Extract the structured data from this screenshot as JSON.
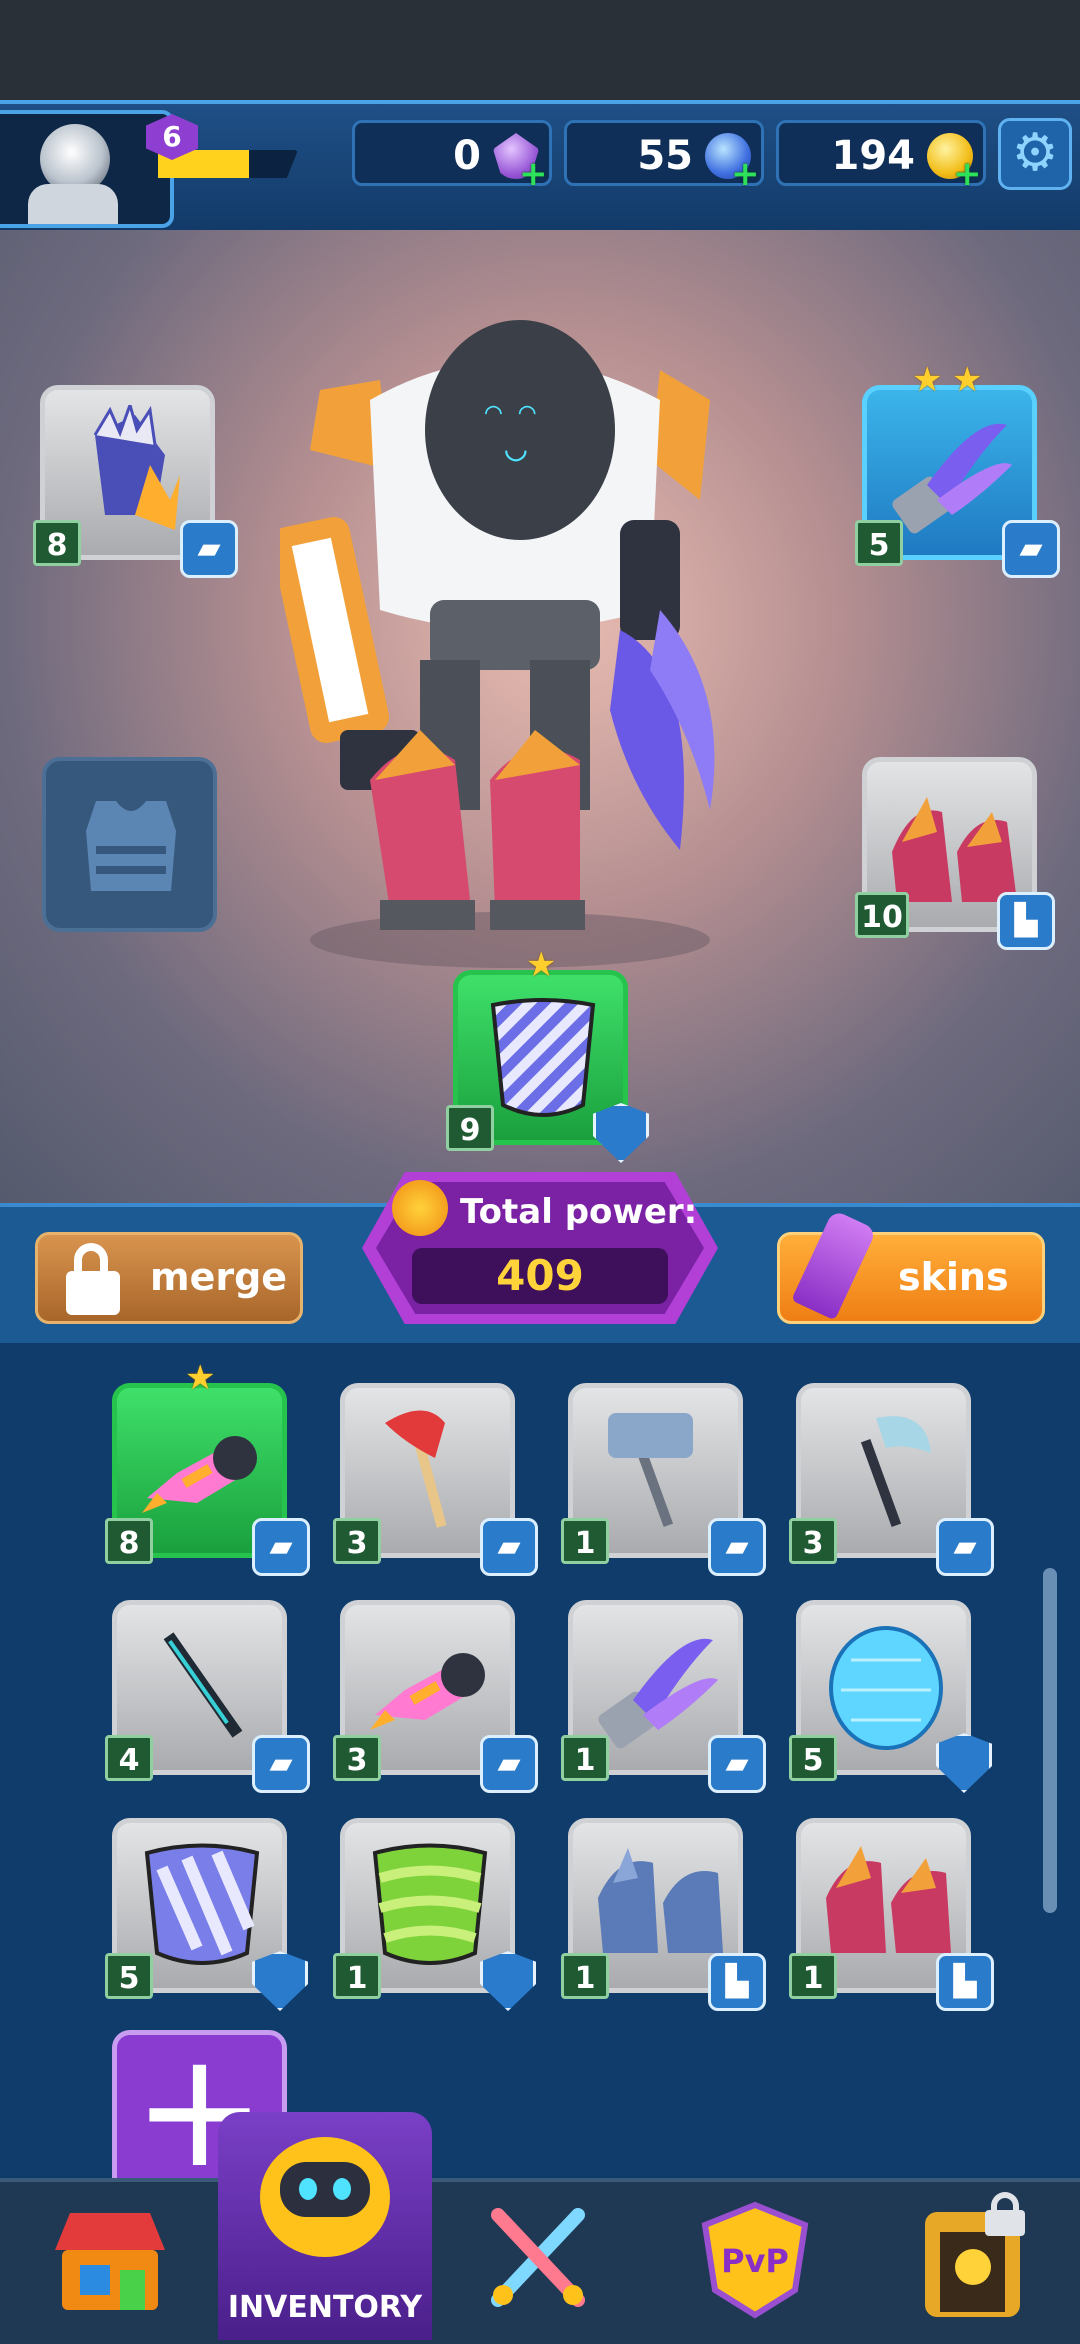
{
  "player": {
    "level": "6",
    "xp_progress": 0.65
  },
  "currencies": [
    {
      "name": "gem",
      "value": "0",
      "icon": "purple-gem-icon"
    },
    {
      "name": "crystal",
      "value": "55",
      "icon": "blue-crystal-icon"
    },
    {
      "name": "coin",
      "value": "194",
      "icon": "gold-coin-icon"
    }
  ],
  "equipped": {
    "gloves": {
      "count": "8",
      "type": "weapon"
    },
    "claw": {
      "count": "5",
      "type": "weapon",
      "stars": 2
    },
    "armor": {
      "empty": true
    },
    "boots": {
      "count": "10",
      "type": "boots"
    },
    "shield": {
      "count": "9",
      "type": "shield",
      "stars": 1
    }
  },
  "actions": {
    "merge_label": "merge",
    "skins_label": "skins",
    "total_power_label": "Total power:",
    "total_power_value": "409"
  },
  "inventory": [
    {
      "item": "rocket",
      "count": "8",
      "type": "weapon",
      "equipped": true,
      "stars": 1
    },
    {
      "item": "fire-axe",
      "count": "3",
      "type": "weapon"
    },
    {
      "item": "war-hammer",
      "count": "1",
      "type": "weapon"
    },
    {
      "item": "battle-axe",
      "count": "3",
      "type": "weapon"
    },
    {
      "item": "sword",
      "count": "4",
      "type": "weapon"
    },
    {
      "item": "rocket",
      "count": "3",
      "type": "weapon"
    },
    {
      "item": "claw",
      "count": "1",
      "type": "weapon"
    },
    {
      "item": "energy-shield",
      "count": "5",
      "type": "shield"
    },
    {
      "item": "striped-shield",
      "count": "5",
      "type": "shield"
    },
    {
      "item": "green-shield",
      "count": "1",
      "type": "shield"
    },
    {
      "item": "blue-boots",
      "count": "1",
      "type": "boots"
    },
    {
      "item": "red-boots",
      "count": "1",
      "type": "boots"
    }
  ],
  "nav": {
    "active_label": "INVENTORY",
    "items": [
      "shop",
      "inventory",
      "battle",
      "pvp",
      "dungeon"
    ],
    "pvp_label": "PvP"
  }
}
